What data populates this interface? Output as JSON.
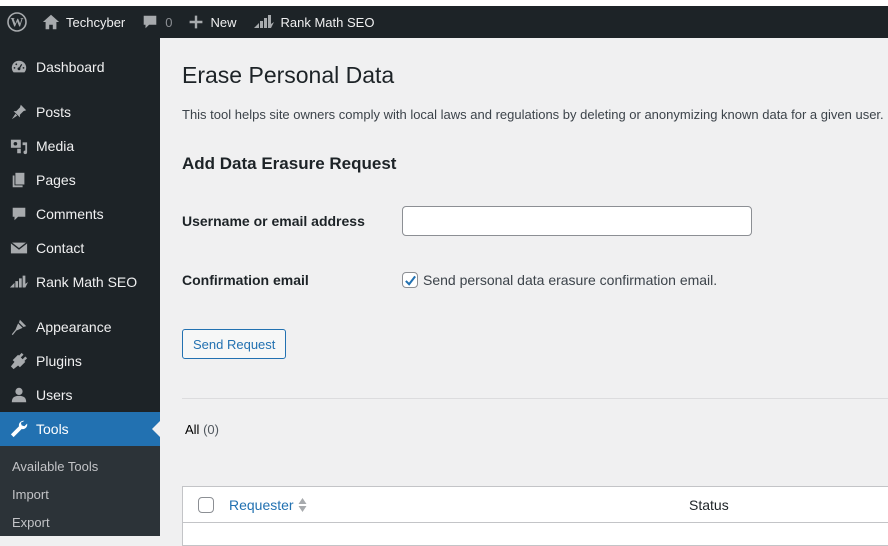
{
  "admin_bar": {
    "wp_logo_icon": "wordpress-logo-icon",
    "site_name": "Techcyber",
    "comments_count": "0",
    "new_label": "New",
    "rank_math_label": "Rank Math SEO"
  },
  "sidebar": {
    "items": [
      {
        "label": "Dashboard",
        "icon": "dashboard-icon"
      },
      {
        "label": "Posts",
        "icon": "pin-icon"
      },
      {
        "label": "Media",
        "icon": "media-icon"
      },
      {
        "label": "Pages",
        "icon": "pages-icon"
      },
      {
        "label": "Comments",
        "icon": "comment-icon"
      },
      {
        "label": "Contact",
        "icon": "envelope-icon"
      },
      {
        "label": "Rank Math SEO",
        "icon": "rank-math-icon"
      },
      {
        "label": "Appearance",
        "icon": "brush-icon"
      },
      {
        "label": "Plugins",
        "icon": "plug-icon"
      },
      {
        "label": "Users",
        "icon": "user-icon"
      },
      {
        "label": "Tools",
        "icon": "wrench-icon",
        "active": true
      }
    ],
    "submenu": [
      "Available Tools",
      "Import",
      "Export"
    ]
  },
  "main": {
    "title": "Erase Personal Data",
    "description": "This tool helps site owners comply with local laws and regulations by deleting or anonymizing known data for a given user.",
    "form_title": "Add Data Erasure Request",
    "username_label": "Username or email address",
    "username_value": "",
    "confirmation_label": "Confirmation email",
    "confirmation_checked": true,
    "confirmation_text": "Send personal data erasure confirmation email.",
    "send_button": "Send Request",
    "filter_all": "All",
    "filter_count": "(0)",
    "table": {
      "columns": [
        "Requester",
        "Status"
      ]
    }
  },
  "colors": {
    "accent": "#2271b1",
    "sidebar_bg": "#1d2327",
    "page_bg": "#f0f0f1"
  }
}
